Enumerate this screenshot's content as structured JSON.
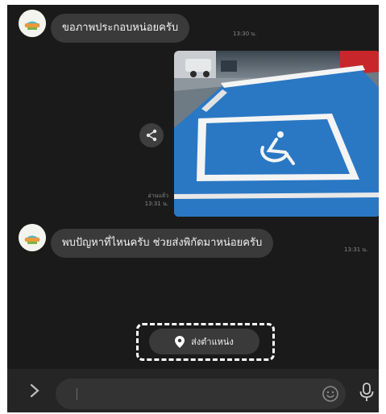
{
  "messages": [
    {
      "text": "ขอภาพประกอบหน่อยครับ",
      "time": "13:30 น."
    },
    {
      "read": "อ่านแล้ว",
      "time": "13:31 น."
    },
    {
      "text": "พบปัญหาที่ไหนครับ ช่วยส่งพิกัดมาหน่อยครับ",
      "time": "13:31 น."
    }
  ],
  "photo": {
    "icon": "wheelchair-icon"
  },
  "quick_reply": {
    "label": "ส่งตำแหน่ง",
    "icon": "location-pin-icon"
  },
  "composer": {
    "placeholder": "",
    "emoji_icon": "emoji-icon",
    "mic_icon": "microphone-icon",
    "expand_icon": "chevron-right-icon"
  },
  "colors": {
    "background": "#1a1a1a",
    "bubble": "#3a3a3a",
    "parking_blue": "#2a78c4"
  }
}
